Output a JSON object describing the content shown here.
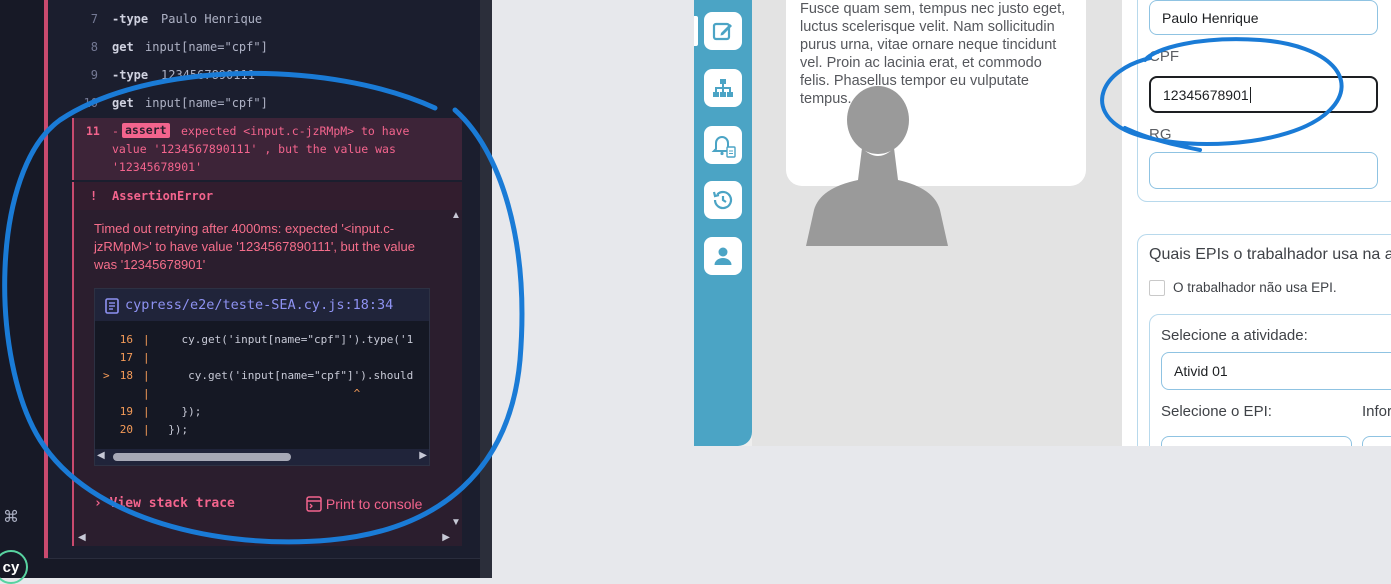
{
  "runner": {
    "commands": [
      {
        "num": "7",
        "name": "-type",
        "arg": "Paulo Henrique"
      },
      {
        "num": "8",
        "name": "get",
        "arg": "input[name=\"cpf\"]"
      },
      {
        "num": "9",
        "name": "-type",
        "arg": "1234567890111"
      },
      {
        "num": "10",
        "name": "get",
        "arg": "input[name=\"cpf\"]"
      }
    ],
    "assert": {
      "num": "11",
      "badge": "assert",
      "line1": "expected <input.c-jzRMpM> to have",
      "line2": "value '1234567890111' , but the value was",
      "line3": "'12345678901'"
    },
    "error": {
      "bang": "!",
      "title": "AssertionError",
      "message": "Timed out retrying after 4000ms: expected '<input.c-jzRMpM>' to have value '1234567890111', but the value was '12345678901'",
      "file": "cypress/e2e/teste-SEA.cy.js:18:34",
      "code": [
        {
          "ln": "16",
          "marker": "",
          "text": "    cy.get('input[name=\"cpf\"]').type('1"
        },
        {
          "ln": "17",
          "marker": "",
          "text": ""
        },
        {
          "ln": "18",
          "marker": ">",
          "text": "     cy.get('input[name=\"cpf\"]').should"
        },
        {
          "ln": "",
          "marker": "",
          "text": "                              ^"
        },
        {
          "ln": "19",
          "marker": "",
          "text": "    });"
        },
        {
          "ln": "20",
          "marker": "",
          "text": "  });"
        }
      ],
      "stack_label": "View stack trace",
      "print_label": "Print to console"
    },
    "logo": "cy"
  },
  "app": {
    "lorem": "Fusce quam sem, tempus nec justo eget, luctus scelerisque velit. Nam sollicitudin purus urna, vitae ornare neque tincidunt vel. Proin ac lacinia erat, et commodo felis. Phasellus tempor eu vulputate tempus.",
    "sidebar_icons": [
      "edit-icon",
      "org-chart-icon",
      "bell-document-icon",
      "history-icon",
      "person-icon"
    ],
    "name_value": "Paulo Henrique",
    "cpf_label": "CPF",
    "cpf_value": "12345678901",
    "rg_label": "RG",
    "rg_value": "",
    "epi_question": "Quais EPIs o trabalhador usa na a",
    "no_epi_label": "O trabalhador não usa EPI.",
    "activity_label": "Selecione a atividade:",
    "activity_value": "Ativid 01",
    "epi_label": "Selecione o EPI:",
    "info_label": "Infor"
  },
  "colors": {
    "accent_red": "#c94a6e",
    "sidebar_blue": "#4ba4c5",
    "annotation_blue": "#1a7bd6"
  }
}
